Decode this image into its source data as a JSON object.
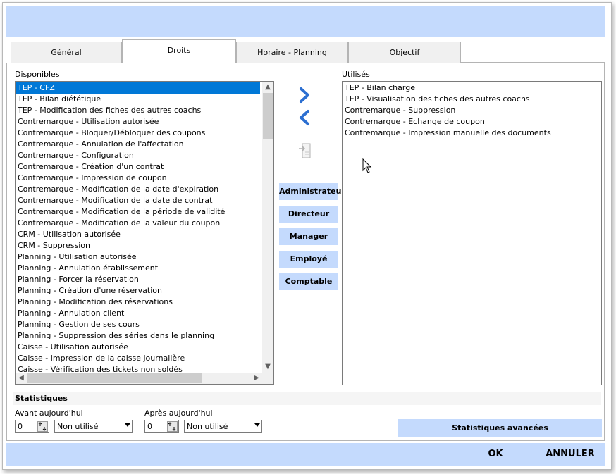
{
  "tabs": [
    "Général",
    "Droits",
    "Horaire - Planning",
    "Objectif"
  ],
  "available": {
    "label": "Disponibles",
    "items": [
      "TEP - CFZ",
      "TEP - Bilan diététique",
      "TEP - Modification des fiches des autres coachs",
      "Contremarque - Utilisation autorisée",
      "Contremarque - Bloquer/Débloquer des coupons",
      "Contremarque - Annulation de l'affectation",
      "Contremarque - Configuration",
      "Contremarque - Création d'un contrat",
      "Contremarque - Impression de coupon",
      "Contremarque - Modification de la date d'expiration",
      "Contremarque - Modification de la date de contrat",
      "Contremarque - Modification de la période de validité",
      "Contremarque - Modification de la valeur du coupon",
      "CRM - Utilisation autorisée",
      "CRM - Suppression",
      "Planning - Utilisation autorisée",
      "Planning - Annulation établissement",
      "Planning - Forcer la réservation",
      "Planning - Création d'une réservation",
      "Planning - Modification des réservations",
      "Planning - Annulation client",
      "Planning - Gestion de ses cours",
      "Planning - Suppression des séries dans le planning",
      "Caisse - Utilisation autorisée",
      "Caisse - Impression de la caisse journalière",
      "Caisse - Vérification des tickets non soldés"
    ]
  },
  "used": {
    "label": "Utilisés",
    "items": [
      "TEP - Bilan charge",
      "TEP - Visualisation des fiches des autres coachs",
      "Contremarque - Suppression",
      "Contremarque - Echange de coupon",
      "Contremarque - Impression manuelle des documents"
    ]
  },
  "roles": [
    "Administrateur",
    "Directeur",
    "Manager",
    "Employé",
    "Comptable"
  ],
  "stats": {
    "title": "Statistiques",
    "before_label": "Avant aujourd'hui",
    "before_value": "0",
    "before_select": "Non utilisé",
    "after_label": "Après aujourd'hui",
    "after_value": "0",
    "after_select": "Non utilisé",
    "advanced_button": "Statistiques avancées"
  },
  "footer": {
    "ok": "OK",
    "cancel": "ANNULER"
  },
  "colors": {
    "accent": "#c4dafd",
    "selection": "#0078d7",
    "arrow": "#2c6fd1"
  }
}
